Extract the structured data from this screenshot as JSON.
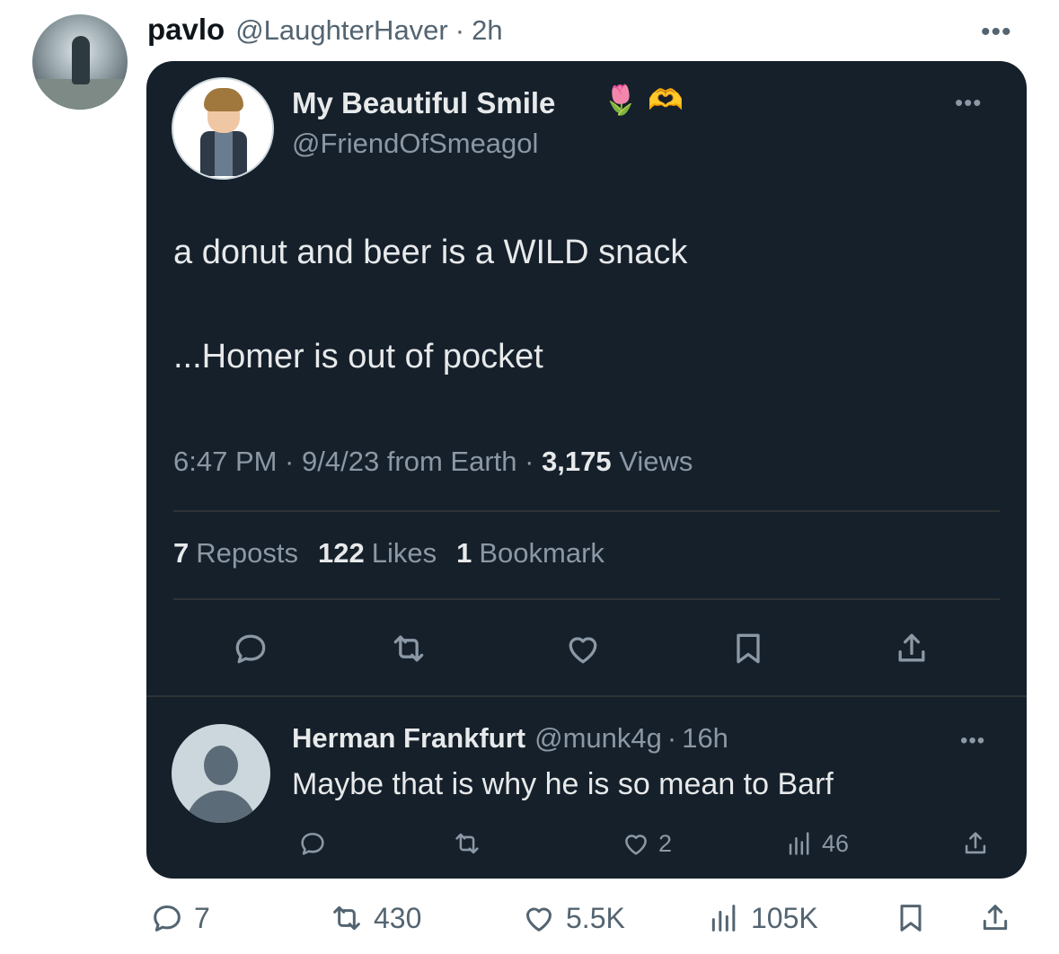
{
  "tweet": {
    "author_name": "pavlo",
    "author_handle": "@LaughterHaver",
    "separator": "·",
    "time": "2h",
    "more": "•••",
    "actions": {
      "replies": "7",
      "reposts": "430",
      "likes": "5.5K",
      "views": "105K"
    }
  },
  "quoted": {
    "author_name": "My Beautiful Smile",
    "emoji_1": "🌷",
    "emoji_2": "🫶",
    "author_handle": "@FriendOfSmeagol",
    "more": "•••",
    "line1": "a donut and beer is a WILD snack",
    "line2": "...Homer is out of pocket",
    "meta_time": "6:47 PM · 9/4/23 from Earth · ",
    "meta_views_count": "3,175",
    "meta_views_label": " Views",
    "stats": {
      "reposts_count": "7",
      "reposts_label": "Reposts",
      "likes_count": "122",
      "likes_label": "Likes",
      "bookmarks_count": "1",
      "bookmarks_label": "Bookmark"
    }
  },
  "reply": {
    "author_name": "Herman Frankfurt",
    "author_handle": "@munk4g",
    "separator": "·",
    "time": "16h",
    "more": "•••",
    "text": "Maybe that is why he is so mean to Barf",
    "likes": "2",
    "views": "46"
  },
  "icons": [
    "reply-icon",
    "repost-icon",
    "like-icon",
    "bookmark-icon",
    "share-icon",
    "views-icon",
    "more-icon"
  ],
  "colors": {
    "card_bg": "#15202b",
    "card_text": "#e7e9ea",
    "card_muted": "#8b98a5",
    "page_muted": "#536471"
  }
}
